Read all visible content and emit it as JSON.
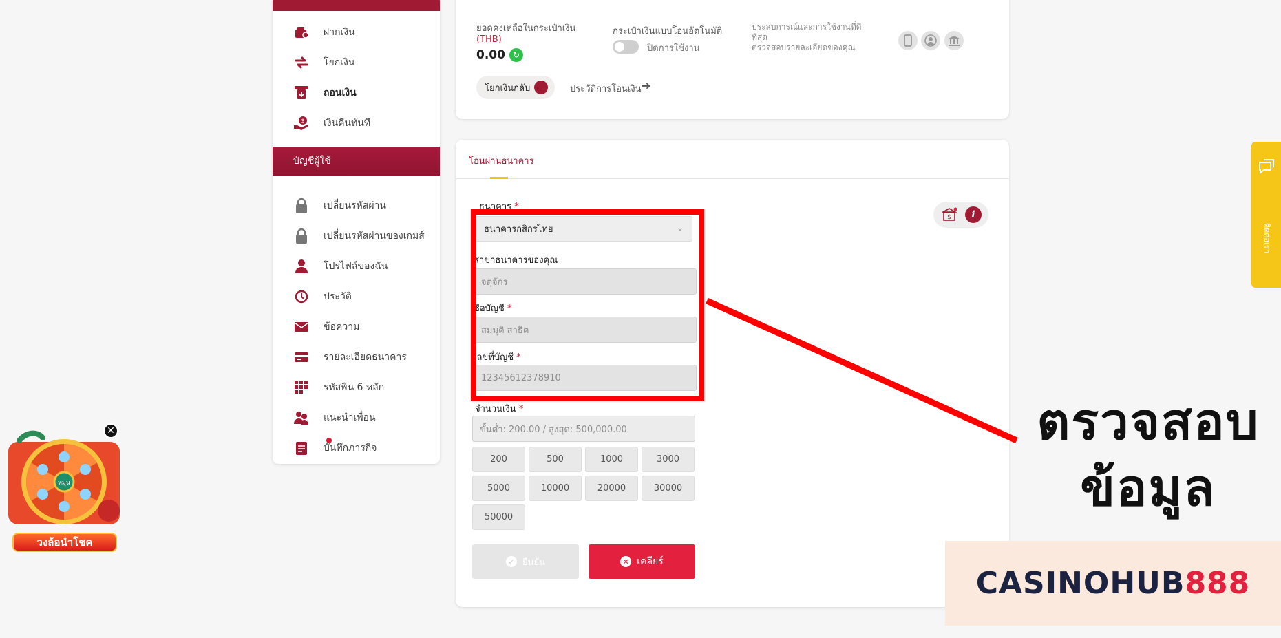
{
  "sidebar": {
    "items_top": [
      {
        "label": "ฝากเงิน",
        "icon": "wallet-icon"
      },
      {
        "label": "โยกเงิน",
        "icon": "swap-icon"
      },
      {
        "label": "ถอนเงิน",
        "icon": "withdraw-icon"
      },
      {
        "label": "เงินคืนทันที",
        "icon": "cashback-icon"
      }
    ],
    "section_title": "บัญชีผู้ใช้",
    "items_account": [
      {
        "label": "เปลี่ยนรหัสผ่าน",
        "icon": "lock-icon"
      },
      {
        "label": "เปลี่ยนรหัสผ่านของเกมส์",
        "icon": "lock-icon"
      },
      {
        "label": "โปรไฟล์ของฉัน",
        "icon": "user-icon"
      },
      {
        "label": "ประวัติ",
        "icon": "history-icon"
      },
      {
        "label": "ข้อความ",
        "icon": "mail-icon"
      },
      {
        "label": "รายละเอียดธนาคาร",
        "icon": "card-icon"
      },
      {
        "label": "รหัสพิน 6 หลัก",
        "icon": "pin-icon"
      },
      {
        "label": "แนะนำเพื่อน",
        "icon": "friends-icon"
      },
      {
        "label": "บันทึกภารกิจ",
        "icon": "mission-icon"
      }
    ]
  },
  "wallet": {
    "balance_label": "ยอดคงเหลือในกระเป๋าเงิน",
    "currency": "(THB)",
    "balance": "0.00",
    "auto_transfer_label": "กระเป๋าเงินแบบโอนอัตโนมัติ",
    "toggle_status": "ปิดการใช้งาน",
    "experience_label": "ประสบการณ์และการใช้งานที่ดีที่สุด",
    "experience_sub": "ตรวจสอบรายละเอียดของคุณ",
    "transfer_back": "โยกเงินกลับ",
    "transfer_history": "ประวัติการโอนเงิน"
  },
  "form": {
    "tab": "โอนผ่านธนาคาร",
    "bank_label": "ธนาคาร",
    "bank_value": "ธนาคารกสิกรไทย",
    "branch_label": "สาขาธนาคารของคุณ",
    "branch_value": "จตุจักร",
    "account_name_label": "ชื่อบัญชี",
    "account_name_value": "สมมุติ สาธิต",
    "account_number_label": "เลขที่บัญชี",
    "account_number_value": "12345612378910",
    "amount_label": "จำนวนเงิน",
    "amount_placeholder": "ขั้นต่ำ: 200.00 / สูงสุด: 500,000.00",
    "required_mark": "*",
    "amount_options": [
      "200",
      "500",
      "1000",
      "3000",
      "5000",
      "10000",
      "20000",
      "30000",
      "50000"
    ],
    "confirm_label": "ยืนยัน",
    "clear_label": "เคลียร์"
  },
  "annotation": {
    "line1": "ตรวจสอบ",
    "line2": "ข้อมูล"
  },
  "side_tab_label": "ติดต่อเรา",
  "watermark": {
    "part1": "CASINOHUB",
    "part2": "888"
  },
  "wheel": {
    "label": "วงล้อนำโชค",
    "center": "หมุน"
  },
  "colors": {
    "brand": "#a01a33",
    "accent": "#e3213f",
    "highlight": "#ff0000",
    "side_tab": "#f5c518"
  }
}
